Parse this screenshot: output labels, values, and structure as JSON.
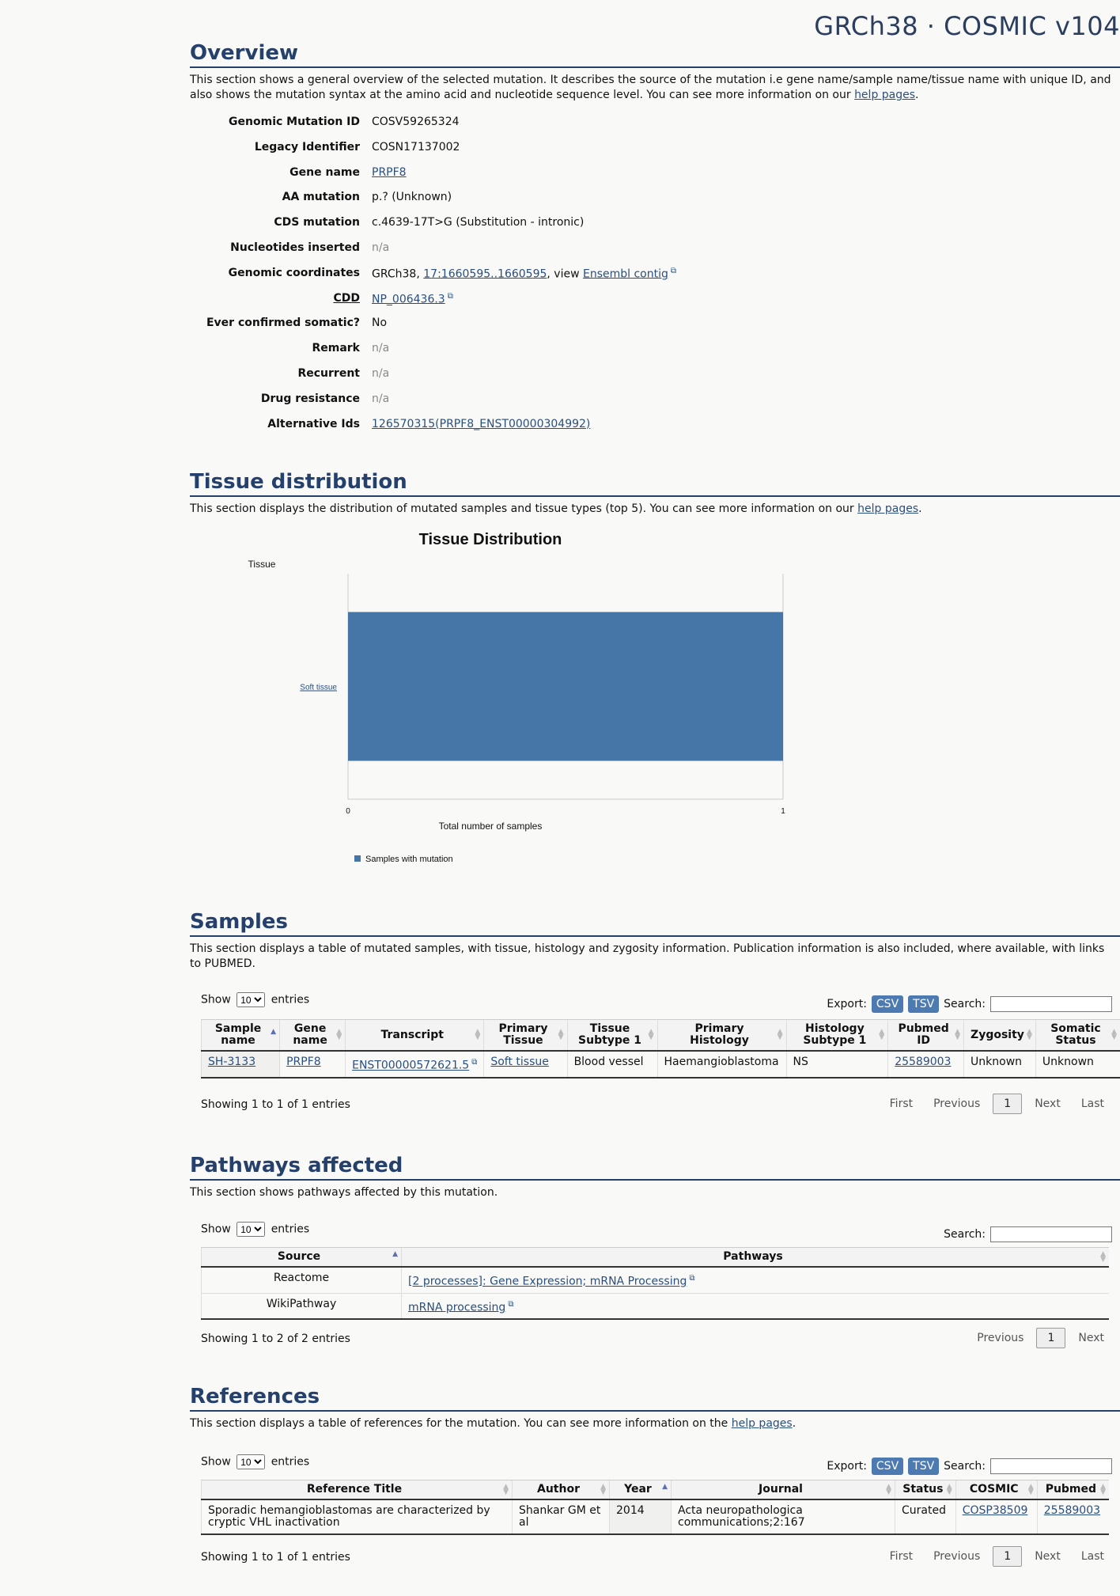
{
  "header": {
    "title": "GRCh38 · COSMIC v104"
  },
  "overview": {
    "title": "Overview",
    "desc_part1": "This section shows a general overview of the selected mutation. It describes the source of the mutation i.e gene name/sample name/tissue name with unique ID, and also shows the mutation syntax at the amino acid and nucleotide sequence level. You can see more information on our ",
    "help_link": "help pages",
    "desc_end": ".",
    "rows": {
      "gmid": {
        "key": "Genomic Mutation ID",
        "value": "COSV59265324"
      },
      "legacy": {
        "key": "Legacy Identifier",
        "value": "COSN17137002"
      },
      "gene": {
        "key": "Gene name",
        "value": "PRPF8"
      },
      "aa": {
        "key": "AA mutation",
        "value": "p.? (Unknown)"
      },
      "cds": {
        "key": "CDS mutation",
        "value": "c.4639-17T>G (Substitution - intronic)"
      },
      "nuc": {
        "key": "Nucleotides inserted",
        "value": "n/a"
      },
      "coords": {
        "key": "Genomic coordinates",
        "prefix": "GRCh38, ",
        "link": "17:1660595..1660595",
        "mid": ", view ",
        "link2": "Ensembl contig"
      },
      "cdd": {
        "key": "CDD",
        "value": "NP_006436.3"
      },
      "confirmed": {
        "key": "Ever confirmed somatic?",
        "value": "No"
      },
      "remark": {
        "key": "Remark",
        "value": "n/a"
      },
      "recurrent": {
        "key": "Recurrent",
        "value": "n/a"
      },
      "drug": {
        "key": "Drug resistance",
        "value": "n/a"
      },
      "altids": {
        "key": "Alternative Ids",
        "value": "126570315(PRPF8_ENST00000304992)"
      }
    }
  },
  "tissue": {
    "title": "Tissue distribution",
    "desc_part1": "This section displays the distribution of mutated samples and tissue types (top 5). You can see more information on our ",
    "help_link": "help pages",
    "desc_end": "."
  },
  "chart_data": {
    "type": "bar",
    "orientation": "horizontal",
    "title": "Tissue Distribution",
    "ylabel": "Tissue",
    "xlabel": "Total number of samples",
    "categories": [
      "Soft tissue"
    ],
    "series": [
      {
        "name": "Samples with mutation",
        "values": [
          1
        ],
        "color": "#4675a8"
      }
    ],
    "xlim": [
      0,
      1
    ],
    "x_ticks": [
      "0",
      "1"
    ],
    "legend": "bottom"
  },
  "samples": {
    "title": "Samples",
    "desc": "This section displays a table of mutated samples, with tissue, histology and zygosity information. Publication information is also included, where available, with links to PUBMED.",
    "show_label": "Show",
    "show_value": "10",
    "entries_label": "entries",
    "export_label": "Export:",
    "csv": "CSV",
    "tsv": "TSV",
    "search_label": "Search:",
    "columns": [
      "Sample name",
      "Gene name",
      "Transcript",
      "Primary Tissue",
      "Tissue Subtype 1",
      "Primary Histology",
      "Histology Subtype 1",
      "Pubmed ID",
      "Zygosity",
      "Somatic Status"
    ],
    "row": {
      "sample": "SH-3133",
      "gene": "PRPF8",
      "transcript": "ENST00000572621.5",
      "tissue": "Soft tissue",
      "subtype": "Blood vessel",
      "histology": "Haemangioblastoma",
      "hist_sub": "NS",
      "pubmed": "25589003",
      "zygosity": "Unknown",
      "status": "Unknown"
    },
    "info": "Showing 1 to 1 of 1 entries",
    "pager": {
      "first": "First",
      "previous": "Previous",
      "current": "1",
      "next": "Next",
      "last": "Last"
    }
  },
  "pathways": {
    "title": "Pathways affected",
    "desc": "This section shows pathways affected by this mutation.",
    "show_label": "Show",
    "show_value": "10",
    "entries_label": "entries",
    "search_label": "Search:",
    "columns": [
      "Source",
      "Pathways"
    ],
    "rows": [
      {
        "source": "Reactome",
        "pathway": "[2 processes]: Gene Expression; mRNA Processing"
      },
      {
        "source": "WikiPathway",
        "pathway": "mRNA processing"
      }
    ],
    "info": "Showing 1 to 2 of 2 entries",
    "pager": {
      "previous": "Previous",
      "current": "1",
      "next": "Next"
    }
  },
  "references": {
    "title": "References",
    "desc_part1": "This section displays a table of references for the mutation. You can see more information on the ",
    "help_link": "help pages",
    "desc_end": ".",
    "show_label": "Show",
    "show_value": "10",
    "entries_label": "entries",
    "export_label": "Export:",
    "csv": "CSV",
    "tsv": "TSV",
    "search_label": "Search:",
    "columns": [
      "Reference Title",
      "Author",
      "Year",
      "Journal",
      "Status",
      "COSMIC",
      "Pubmed"
    ],
    "row": {
      "title": "Sporadic hemangioblastomas are characterized by cryptic VHL inactivation",
      "author": "Shankar GM et al",
      "year": "2014",
      "journal": "Acta neuropathologica communications;2:167",
      "status": "Curated",
      "cosmic": "COSP38509",
      "pubmed": "25589003"
    },
    "info": "Showing 1 to 1 of 1 entries",
    "pager": {
      "first": "First",
      "previous": "Previous",
      "current": "1",
      "next": "Next",
      "last": "Last"
    }
  }
}
